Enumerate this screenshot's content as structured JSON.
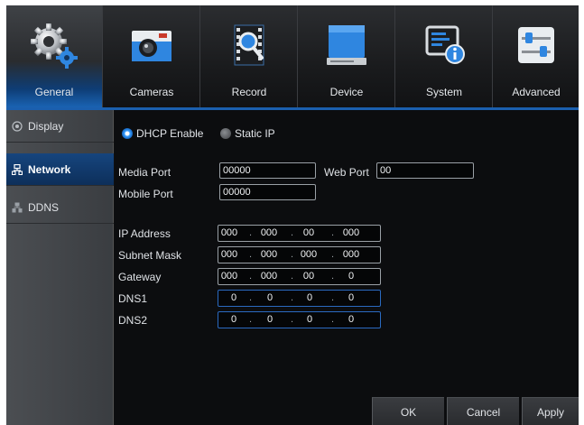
{
  "tabs": [
    {
      "label": "General",
      "icon": "gears-icon",
      "active": true
    },
    {
      "label": "Cameras",
      "icon": "camera-icon",
      "active": false
    },
    {
      "label": "Record",
      "icon": "record-icon",
      "active": false
    },
    {
      "label": "Device",
      "icon": "hard-drive-icon",
      "active": false
    },
    {
      "label": "System",
      "icon": "system-info-icon",
      "active": false
    },
    {
      "label": "Advanced",
      "icon": "sliders-icon",
      "active": false
    }
  ],
  "sidebar": {
    "items": [
      {
        "label": "Display",
        "icon": "display-radio-icon",
        "active": false
      },
      {
        "label": "Network",
        "icon": "network-icon",
        "active": true
      },
      {
        "label": "DDNS",
        "icon": "ddns-icon",
        "active": false
      }
    ]
  },
  "network": {
    "mode_dhcp": "DHCP Enable",
    "mode_static": "Static IP",
    "dhcp_selected": true,
    "media_port_label": "Media Port",
    "media_port_value": "00000",
    "web_port_label": "Web Port",
    "web_port_value": "00",
    "mobile_port_label": "Mobile Port",
    "mobile_port_value": "00000",
    "ip_fields": [
      {
        "label": "IP Address",
        "octets": [
          "000",
          "000",
          "00",
          "000"
        ]
      },
      {
        "label": "Subnet Mask",
        "octets": [
          "000",
          "000",
          "000",
          "000"
        ]
      },
      {
        "label": "Gateway",
        "octets": [
          "000",
          "000",
          "00",
          "0"
        ]
      },
      {
        "label": "DNS1",
        "octets": [
          "0",
          "0",
          "0",
          "0"
        ]
      },
      {
        "label": "DNS2",
        "octets": [
          "0",
          "0",
          "0",
          "0"
        ]
      }
    ]
  },
  "buttons": {
    "ok": "OK",
    "cancel": "Cancel",
    "apply": "Apply"
  },
  "colors": {
    "accent": "#1b5fae",
    "background": "#0c0d0f",
    "sidebar": "#45484c"
  }
}
